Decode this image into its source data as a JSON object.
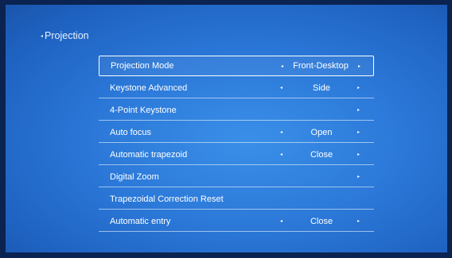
{
  "header": {
    "back_icon": "◂",
    "title": "Projection"
  },
  "menu": {
    "items": [
      {
        "label": "Projection Mode",
        "value": "Front-Desktop",
        "left_arrow": "◂",
        "right_arrow": "▸"
      },
      {
        "label": "Keystone Advanced",
        "value": "Side",
        "left_arrow": "◂",
        "right_arrow": "▸"
      },
      {
        "label": "4-Point Keystone",
        "value": "",
        "left_arrow": "",
        "right_arrow": "▸"
      },
      {
        "label": "Auto focus",
        "value": "Open",
        "left_arrow": "◂",
        "right_arrow": "▸"
      },
      {
        "label": "Automatic trapezoid",
        "value": "Close",
        "left_arrow": "◂",
        "right_arrow": "▸"
      },
      {
        "label": "Digital Zoom",
        "value": "",
        "left_arrow": "",
        "right_arrow": "▸"
      },
      {
        "label": "Trapezoidal Correction Reset",
        "value": "",
        "left_arrow": "",
        "right_arrow": ""
      },
      {
        "label": "Automatic entry",
        "value": "Close",
        "left_arrow": "◂",
        "right_arrow": "▸"
      }
    ]
  },
  "colors": {
    "background": "#2b78d8",
    "text": "#ffffff"
  }
}
